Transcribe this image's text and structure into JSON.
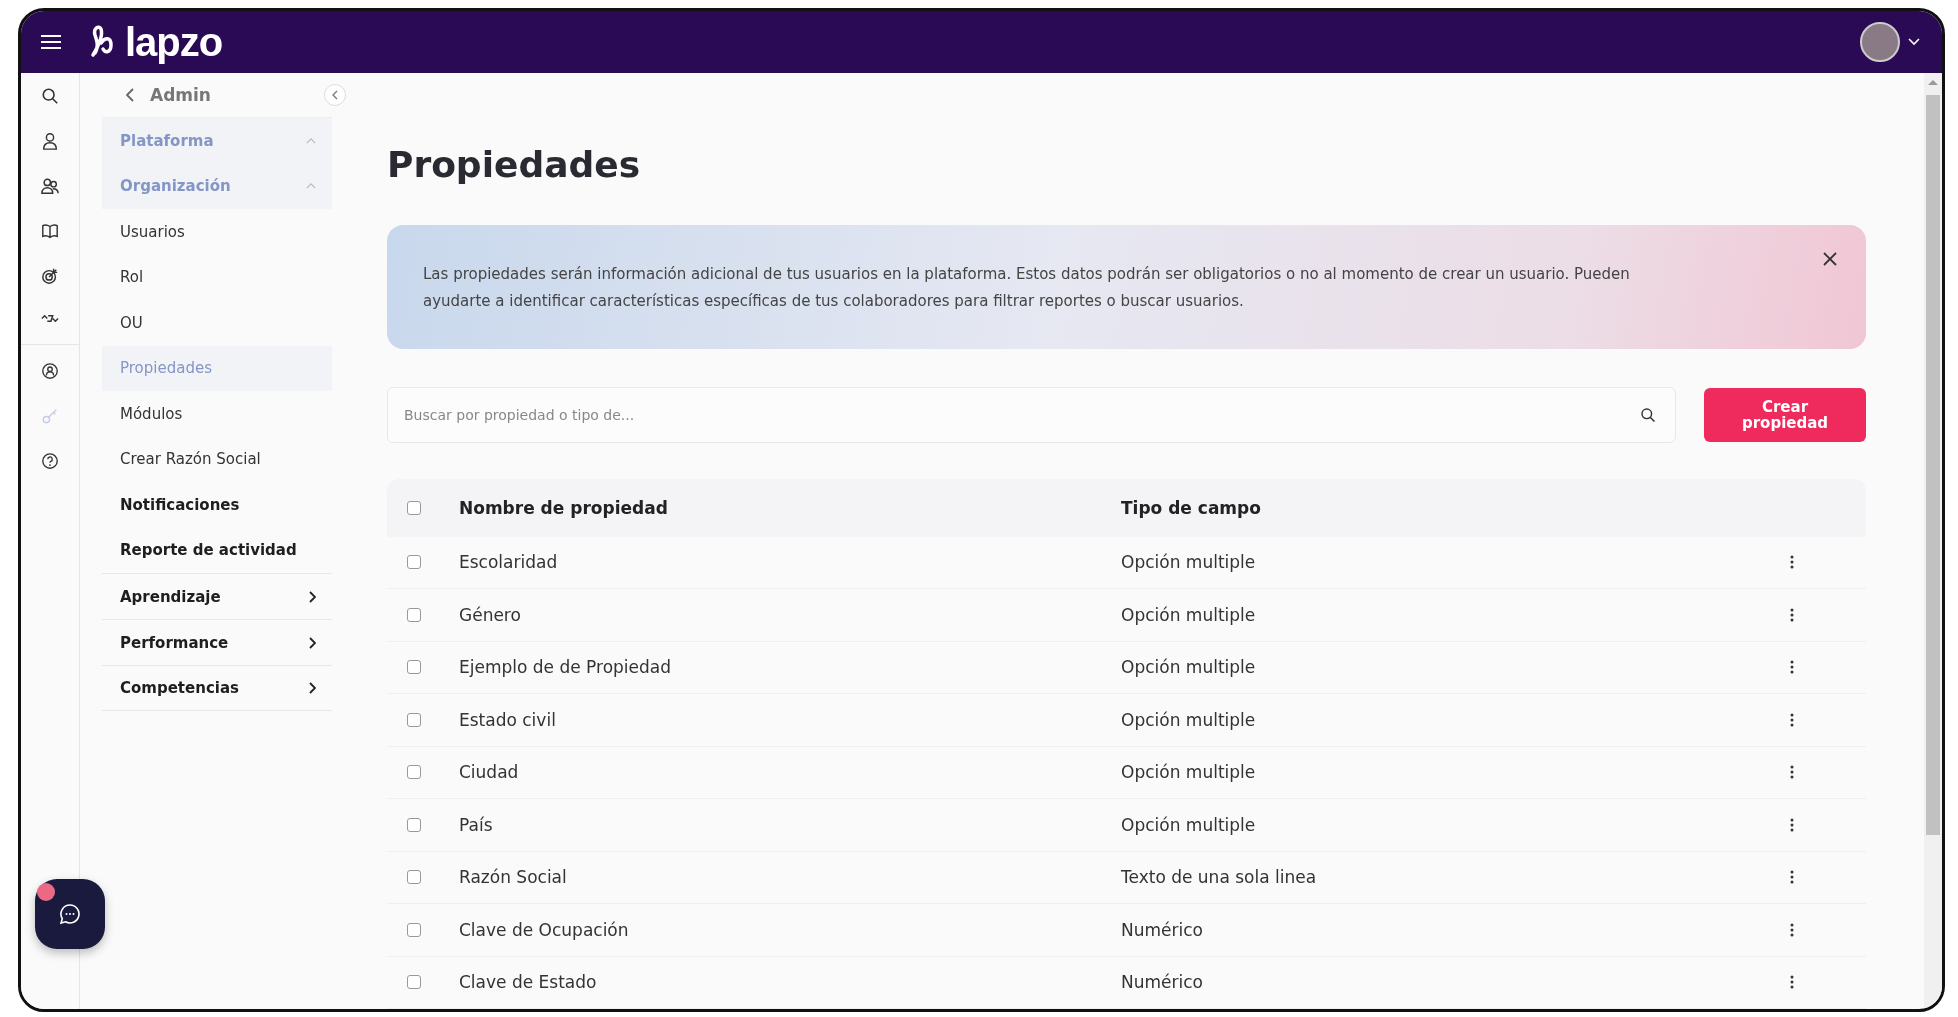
{
  "header": {
    "logo": "lapzo"
  },
  "sidebar": {
    "back_label": "Admin",
    "items": [
      {
        "label": "Plataforma",
        "kind": "section",
        "dimmed": true
      },
      {
        "label": "Organización",
        "kind": "section",
        "dimmed": true
      },
      {
        "label": "Usuarios",
        "kind": "link",
        "dimmed": false
      },
      {
        "label": "Rol",
        "kind": "link",
        "dimmed": false
      },
      {
        "label": "OU",
        "kind": "link",
        "dimmed": false
      },
      {
        "label": "Propiedades",
        "kind": "link",
        "dimmed": true
      },
      {
        "label": "Módulos",
        "kind": "link",
        "dimmed": false
      },
      {
        "label": "Crear Razón Social",
        "kind": "link",
        "dimmed": false
      },
      {
        "label": "Notificaciones",
        "kind": "strong",
        "dimmed": false
      },
      {
        "label": "Reporte de actividad",
        "kind": "strong",
        "dimmed": false
      },
      {
        "label": "Aprendizaje",
        "kind": "group",
        "dimmed": false
      },
      {
        "label": "Performance",
        "kind": "group",
        "dimmed": false
      },
      {
        "label": "Competencias",
        "kind": "group",
        "dimmed": false
      }
    ]
  },
  "page_title": "Propiedades",
  "info_banner": {
    "text": "Las propiedades serán información adicional de tus usuarios en la plataforma. Estos datos podrán ser obligatorios o no al momento de crear un usuario. Pueden ayudarte a identificar características específicas de tus colaboradores para filtrar reportes o buscar usuarios."
  },
  "search": {
    "placeholder": "Buscar por propiedad o tipo de..."
  },
  "create_button": "Crear propiedad",
  "table": {
    "columns": [
      "Nombre de propiedad",
      "Tipo de campo"
    ],
    "all_checked": false,
    "rows": [
      {
        "name": "Escolaridad",
        "type": "Opción multiple",
        "checked": false
      },
      {
        "name": "Género",
        "type": "Opción multiple",
        "checked": false
      },
      {
        "name": "Ejemplo de de Propiedad",
        "type": "Opción multiple",
        "checked": false
      },
      {
        "name": "Estado civil",
        "type": "Opción multiple",
        "checked": false
      },
      {
        "name": "Ciudad",
        "type": "Opción multiple",
        "checked": false
      },
      {
        "name": "País",
        "type": "Opción multiple",
        "checked": false
      },
      {
        "name": "Razón Social",
        "type": "Texto de una sola linea",
        "checked": false
      },
      {
        "name": "Clave de Ocupación",
        "type": "Numérico",
        "checked": false
      },
      {
        "name": "Clave de Estado",
        "type": "Numérico",
        "checked": false
      }
    ]
  },
  "chat": {
    "has_notification": true
  }
}
